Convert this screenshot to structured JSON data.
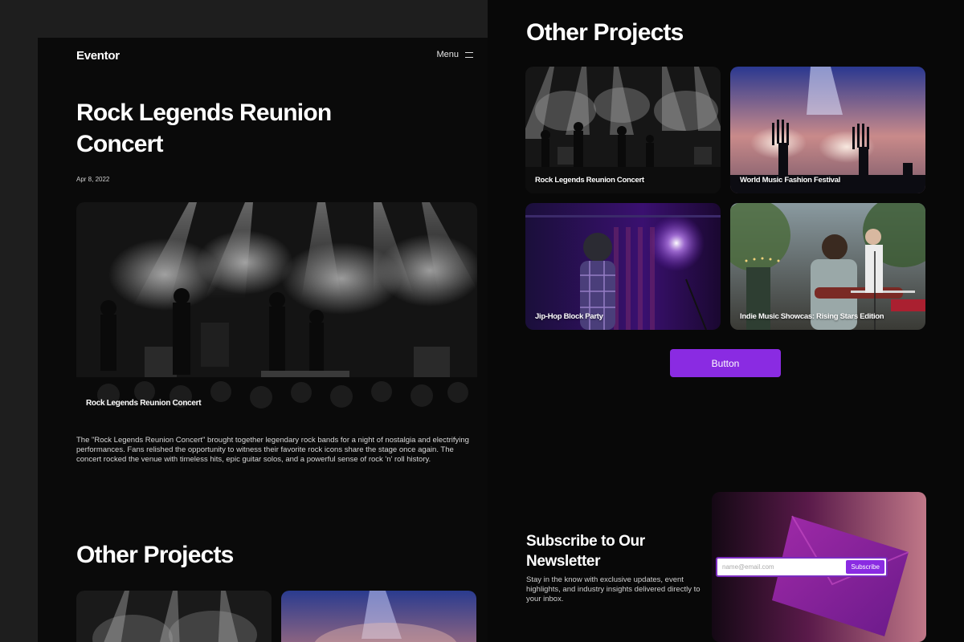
{
  "site": {
    "brand": "Eventor",
    "menu_label": "Menu"
  },
  "article": {
    "title": "Rock Legends Reunion Concert",
    "date": "Apr 8, 2022",
    "hero_caption": "Rock Legends Reunion Concert",
    "body": "The \"Rock Legends Reunion Concert\" brought together legendary rock bands for a night of nostalgia and electrifying performances. Fans relished the opportunity to witness their favorite rock icons share the stage once again. The concert rocked the venue with timeless hits, epic guitar solos, and a powerful sense of rock 'n' roll history."
  },
  "other_projects": {
    "title": "Other Projects",
    "cards": [
      {
        "label": "Rock Legends Reunion Concert"
      },
      {
        "label": "World Music Fashion Festival"
      },
      {
        "label": "Jip-Hop Block Party"
      },
      {
        "label": "Indie Music Showcas: Rising Stars Edition"
      }
    ],
    "button_label": "Button"
  },
  "newsletter": {
    "title": "Subscribe to Our Newsletter",
    "description": "Stay in the know with exclusive updates, event highlights, and industry insights delivered directly to your inbox.",
    "input_placeholder": "name@email.com",
    "subscribe_label": "Subscribe"
  },
  "colors": {
    "accent": "#8a2be2",
    "page_bg": "#0a0a0a",
    "outer_bg": "#1e1e1e"
  }
}
